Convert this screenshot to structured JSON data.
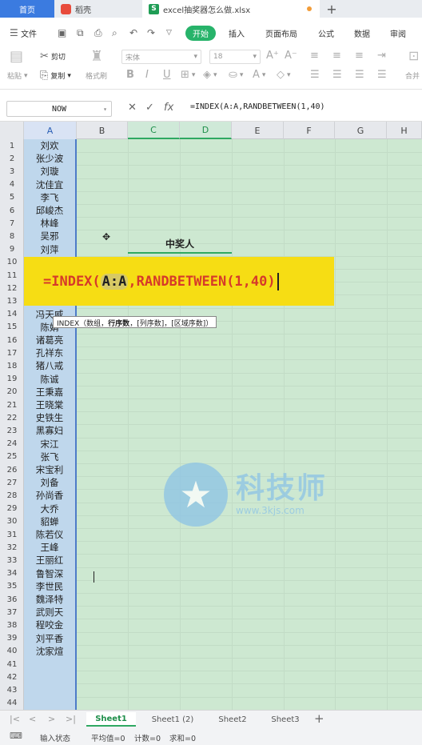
{
  "tabs": {
    "home": "首页",
    "docer": "稻壳",
    "file": "excel抽奖器怎么做.xlsx",
    "add": "+"
  },
  "menu": {
    "file": "文件",
    "start": "开始",
    "insert": "插入",
    "page_layout": "页面布局",
    "formula": "公式",
    "data": "数据",
    "review": "审阅"
  },
  "ribbon": {
    "paste": "粘贴",
    "cut": "剪切",
    "copy": "复制",
    "format_painter": "格式刷",
    "font": "宋体",
    "font_size": "18",
    "merge": "合并"
  },
  "formula_bar": {
    "name_box": "NOW",
    "formula": "=INDEX(A:A,RANDBETWEEN(1,40)"
  },
  "columns": [
    "A",
    "B",
    "C",
    "D",
    "E",
    "F",
    "G",
    "H"
  ],
  "rows": [
    "1",
    "2",
    "3",
    "4",
    "5",
    "6",
    "7",
    "8",
    "9",
    "10",
    "11",
    "12",
    "13",
    "14",
    "15",
    "16",
    "17",
    "18",
    "19",
    "20",
    "21",
    "22",
    "23",
    "24",
    "25",
    "26",
    "27",
    "28",
    "29",
    "30",
    "31",
    "32",
    "33",
    "34",
    "35",
    "36",
    "37",
    "38",
    "39",
    "40",
    "41",
    "42",
    "43",
    "44"
  ],
  "names": {
    "r1": "刘欢",
    "r2": "张少波",
    "r3": "刘璇",
    "r4": "沈佳宜",
    "r5": "李飞",
    "r6": "邱峻杰",
    "r7": "林峰",
    "r8": "吴邪",
    "r9": "刘萍",
    "r14": "冯天威",
    "r15": "陈娟",
    "r16": "诸葛亮",
    "r17": "孔祥东",
    "r18": "猪八戒",
    "r19": "陈诚",
    "r20": "王秉嘉",
    "r21": "王晓棠",
    "r22": "史铁生",
    "r23": "黑寡妇",
    "r24": "宋江",
    "r25": "张飞",
    "r26": "宋宝利",
    "r27": "刘备",
    "r28": "孙尚香",
    "r29": "大乔",
    "r30": "貂蝉",
    "r31": "陈若仪",
    "r32": "王峰",
    "r33": "王丽红",
    "r34": "鲁智深",
    "r35": "李世民",
    "r36": "魏泽特",
    "r37": "武则天",
    "r38": "程咬金",
    "r39": "刘平香",
    "r40": "沈家煊"
  },
  "winner_label": "中奖人",
  "formula_overlay": {
    "prefix": "=INDEX(",
    "highlight": "A:A",
    "suffix": ",RANDBETWEEN(1,40)"
  },
  "tooltip": {
    "before": "INDEX（数组，",
    "bold": "行序数",
    "after": "，[列序数]，[区域序数]）"
  },
  "watermark": {
    "title": "科技师",
    "url": "www.3kjs.com"
  },
  "sheets": [
    "Sheet1",
    "Sheet1 (2)",
    "Sheet2",
    "Sheet3"
  ],
  "status": {
    "mode": "输入状态",
    "average": "平均值=0",
    "count": "计数=0",
    "sum": "求和=0"
  },
  "colors": {
    "accent": "#27b36a",
    "banner": "#f6dd14",
    "formula_red": "#d63a2a",
    "grid_bg": "#cde8d1"
  }
}
